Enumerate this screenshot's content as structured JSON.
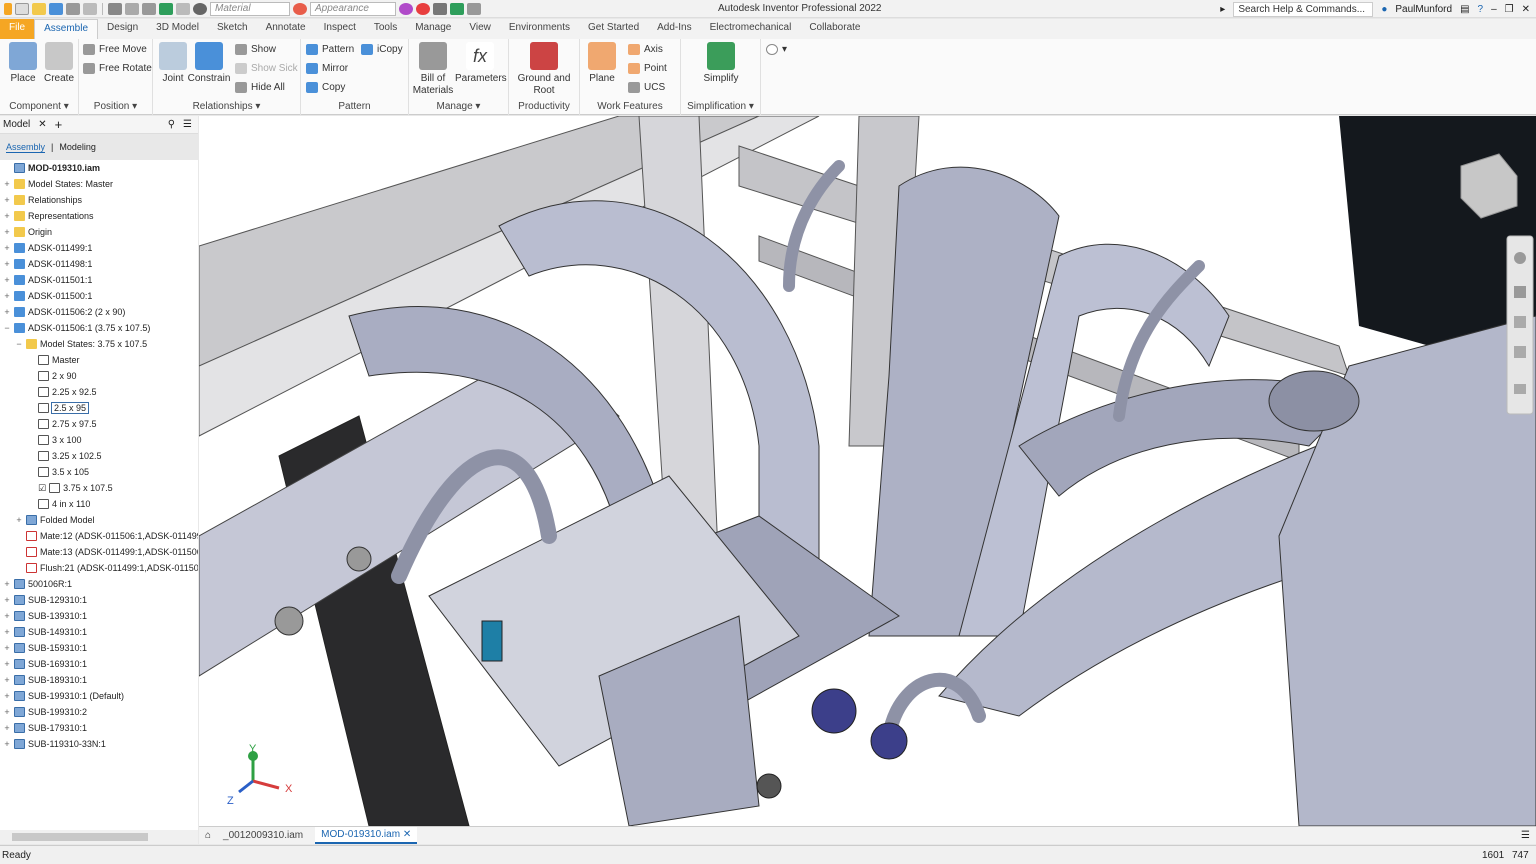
{
  "app": {
    "title": "Autodesk Inventor Professional 2022",
    "material_placeholder": "Material",
    "appearance_placeholder": "Appearance",
    "search_placeholder": "Search Help & Commands...",
    "user": "PaulMunford"
  },
  "tabs": [
    "File",
    "Assemble",
    "Design",
    "3D Model",
    "Sketch",
    "Annotate",
    "Inspect",
    "Tools",
    "Manage",
    "View",
    "Environments",
    "Get Started",
    "Add-Ins",
    "Electromechanical",
    "Collaborate"
  ],
  "ribbon": {
    "component": {
      "label": "Component",
      "place": "Place",
      "create": "Create"
    },
    "position": {
      "label": "Position",
      "free_move": "Free Move",
      "free_rotate": "Free Rotate"
    },
    "relationships": {
      "label": "Relationships",
      "joint": "Joint",
      "constrain": "Constrain",
      "show": "Show",
      "show_sick": "Show Sick",
      "hide_all": "Hide All"
    },
    "pattern": {
      "label": "Pattern",
      "pattern": "Pattern",
      "icopy": "iCopy",
      "mirror": "Mirror",
      "copy": "Copy"
    },
    "manage": {
      "label": "Manage",
      "bom": "Bill of Materials",
      "parameters": "Parameters"
    },
    "productivity": {
      "label": "Productivity",
      "ground_root": "Ground and Root"
    },
    "work_features": {
      "label": "Work Features",
      "plane": "Plane",
      "axis": "Axis",
      "point": "Point",
      "ucs": "UCS"
    },
    "simplification": {
      "label": "Simplification",
      "simplify": "Simplify"
    }
  },
  "browser": {
    "tab_label": "Model",
    "view_assembly": "Assembly",
    "view_modeling": "Modeling",
    "items": [
      {
        "label": "MOD-019310.iam",
        "indent": 0,
        "icon": "sub",
        "bold": true,
        "exp": ""
      },
      {
        "label": "Model States: Master",
        "indent": 0,
        "icon": "folder",
        "exp": "+"
      },
      {
        "label": "Relationships",
        "indent": 0,
        "icon": "folder",
        "exp": "+"
      },
      {
        "label": "Representations",
        "indent": 0,
        "icon": "folder",
        "exp": "+"
      },
      {
        "label": "Origin",
        "indent": 0,
        "icon": "folder",
        "exp": "+"
      },
      {
        "label": "ADSK-011499:1",
        "indent": 0,
        "icon": "part",
        "exp": "+"
      },
      {
        "label": "ADSK-011498:1",
        "indent": 0,
        "icon": "part",
        "exp": "+"
      },
      {
        "label": "ADSK-011501:1",
        "indent": 0,
        "icon": "part",
        "exp": "+"
      },
      {
        "label": "ADSK-011500:1",
        "indent": 0,
        "icon": "part",
        "exp": "+"
      },
      {
        "label": "ADSK-011506:2 (2 x 90)",
        "indent": 0,
        "icon": "part",
        "exp": "+"
      },
      {
        "label": "ADSK-011506:1 (3.75 x 107.5)",
        "indent": 0,
        "icon": "part",
        "exp": "−"
      },
      {
        "label": "Model States: 3.75 x 107.5",
        "indent": 1,
        "icon": "folder",
        "exp": "−"
      },
      {
        "label": "Master",
        "indent": 2,
        "icon": "state",
        "exp": ""
      },
      {
        "label": "2 x 90",
        "indent": 2,
        "icon": "state",
        "exp": ""
      },
      {
        "label": "2.25 x 92.5",
        "indent": 2,
        "icon": "state",
        "exp": ""
      },
      {
        "label": "2.5 x 95",
        "indent": 2,
        "icon": "state",
        "exp": "",
        "selected": true
      },
      {
        "label": "2.75 x 97.5",
        "indent": 2,
        "icon": "state",
        "exp": ""
      },
      {
        "label": "3 x 100",
        "indent": 2,
        "icon": "state",
        "exp": ""
      },
      {
        "label": "3.25 x 102.5",
        "indent": 2,
        "icon": "state",
        "exp": ""
      },
      {
        "label": "3.5 x 105",
        "indent": 2,
        "icon": "state",
        "exp": ""
      },
      {
        "label": "3.75 x 107.5",
        "indent": 2,
        "icon": "state",
        "exp": "",
        "check": true
      },
      {
        "label": "4 in x 110",
        "indent": 2,
        "icon": "state",
        "exp": ""
      },
      {
        "label": "Folded Model",
        "indent": 1,
        "icon": "sub",
        "exp": "+"
      },
      {
        "label": "Mate:12 (ADSK-011506:1,ADSK-011499:",
        "indent": 1,
        "icon": "mate",
        "exp": ""
      },
      {
        "label": "Mate:13 (ADSK-011499:1,ADSK-011506:",
        "indent": 1,
        "icon": "mate",
        "exp": ""
      },
      {
        "label": "Flush:21 (ADSK-011499:1,ADSK-011506",
        "indent": 1,
        "icon": "mate",
        "exp": ""
      },
      {
        "label": "500106R:1",
        "indent": 0,
        "icon": "sub",
        "exp": "+"
      },
      {
        "label": "SUB-129310:1",
        "indent": 0,
        "icon": "sub",
        "exp": "+"
      },
      {
        "label": "SUB-139310:1",
        "indent": 0,
        "icon": "sub",
        "exp": "+"
      },
      {
        "label": "SUB-149310:1",
        "indent": 0,
        "icon": "sub",
        "exp": "+"
      },
      {
        "label": "SUB-159310:1",
        "indent": 0,
        "icon": "sub",
        "exp": "+"
      },
      {
        "label": "SUB-169310:1",
        "indent": 0,
        "icon": "sub",
        "exp": "+"
      },
      {
        "label": "SUB-189310:1",
        "indent": 0,
        "icon": "sub",
        "exp": "+"
      },
      {
        "label": "SUB-199310:1 (Default)",
        "indent": 0,
        "icon": "sub",
        "exp": "+"
      },
      {
        "label": "SUB-199310:2",
        "indent": 0,
        "icon": "sub",
        "exp": "+"
      },
      {
        "label": "SUB-179310:1",
        "indent": 0,
        "icon": "sub",
        "exp": "+"
      },
      {
        "label": "SUB-119310-33N:1",
        "indent": 0,
        "icon": "sub",
        "exp": "+"
      }
    ]
  },
  "doc_tabs": [
    "_0012009310.iam",
    "MOD-019310.iam"
  ],
  "status": {
    "text": "Ready",
    "n1": "1601",
    "n2": "747"
  },
  "axes": {
    "x": "X",
    "y": "Y",
    "z": "Z"
  },
  "colors": {
    "accent": "#1b66b1",
    "file_tab": "#f5a623",
    "model_face": "#b8bccb"
  }
}
